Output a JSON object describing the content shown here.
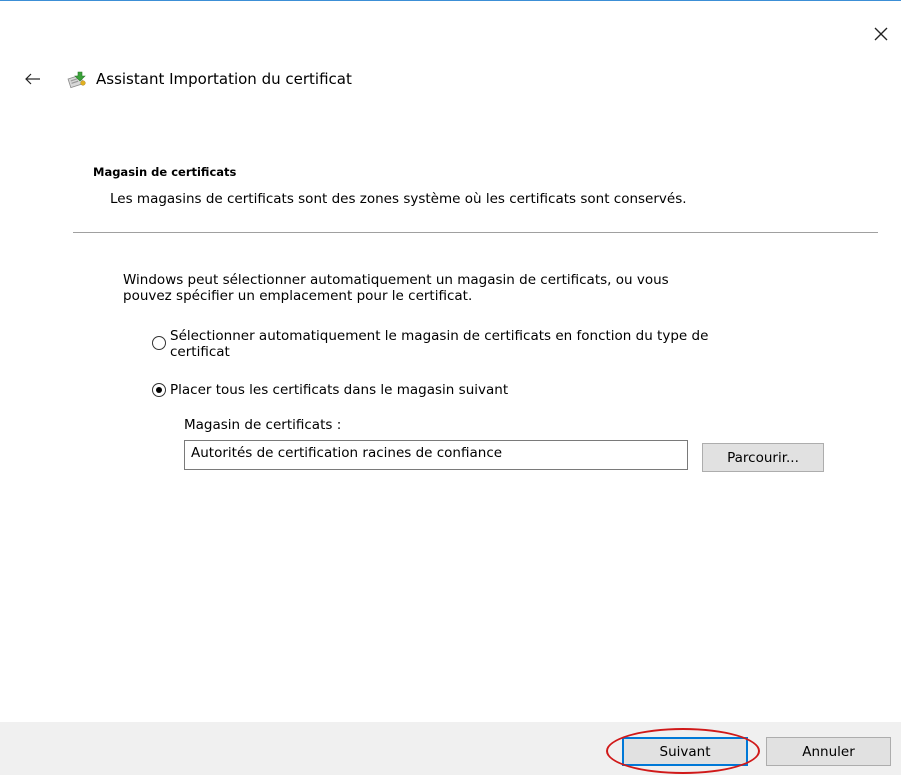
{
  "window": {
    "close_icon": "close-icon",
    "accent_color": "#0078d7",
    "highlight_color": "#d01919"
  },
  "header": {
    "back_icon": "back-arrow-icon",
    "wizard_icon": "certificate-wizard-icon",
    "title": "Assistant Importation du certificat"
  },
  "section": {
    "title": "Magasin de certificats",
    "description": "Les magasins de certificats sont des zones système où les certificats sont conservés."
  },
  "content": {
    "intro_line1": "Windows peut sélectionner automatiquement un magasin de certificats, ou vous",
    "intro_line2": "pouvez spécifier un emplacement pour le certificat.",
    "options": [
      {
        "label_line1": "Sélectionner automatiquement le magasin de certificats en fonction du type de",
        "label_line2": "certificat",
        "selected": false
      },
      {
        "label": "Placer tous les certificats dans le magasin suivant",
        "selected": true
      }
    ],
    "store_label": "Magasin de certificats :",
    "store_value": "Autorités de certification racines de confiance",
    "browse_label": "Parcourir..."
  },
  "footer": {
    "next_label": "Suivant",
    "cancel_label": "Annuler"
  }
}
